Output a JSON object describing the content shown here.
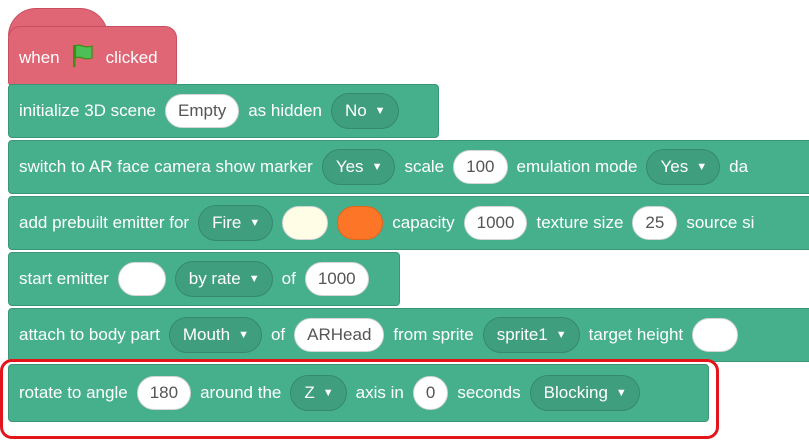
{
  "hat_block": {
    "when": "when",
    "flag_icon": "green-flag-icon",
    "clicked": "clicked"
  },
  "blocks": [
    {
      "t1": "initialize 3D scene",
      "v1": "Empty",
      "t2": "as hidden",
      "dd1": "No"
    },
    {
      "t1": "switch to AR face camera show marker",
      "dd1": "Yes",
      "t2": "scale",
      "v1": "100",
      "t3": "emulation mode",
      "dd2": "Yes",
      "t4": "da"
    },
    {
      "t1": "add prebuilt emitter for",
      "dd1": "Fire",
      "color1": "#fffde6",
      "color2": "#fd7628",
      "t2": "capacity",
      "v1": "1000",
      "t3": "texture size",
      "v2": "25",
      "t4": "source si"
    },
    {
      "t1": "start emitter",
      "dd1": "by rate",
      "t2": "of",
      "v1": "1000"
    },
    {
      "t1": "attach to body part",
      "dd1": "Mouth",
      "t2": "of",
      "v1": "ARHead",
      "t3": "from sprite",
      "dd2": "sprite1",
      "t4": "target height"
    },
    {
      "t1": "rotate to angle",
      "v1": "180",
      "t2": "around the",
      "dd1": "Z",
      "t3": "axis in",
      "v2": "0",
      "t4": "seconds",
      "dd2": "Blocking"
    }
  ],
  "colors": {
    "hat": "#e06575",
    "block": "#46b08c",
    "dropdown": "#3f9e7e",
    "highlight": "#e3151a"
  }
}
